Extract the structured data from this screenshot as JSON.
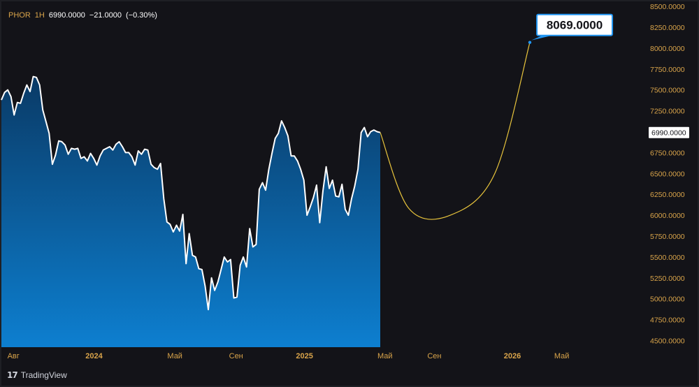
{
  "header": {
    "symbol": "PHOR",
    "interval": "1H",
    "last": "6990.0000",
    "change": "−21.0000",
    "change_pct": "(−0.30%)"
  },
  "branding": {
    "name": "TradingView"
  },
  "colors": {
    "background": "#1e1f24",
    "plot_background": "#131318",
    "price_line": "#ffffff",
    "area_top": "#0a3a66",
    "area_bottom": "#0d7fd0",
    "projection": "#e8c43c",
    "accent": "#2196f3",
    "axis_text": "#d9a44a"
  },
  "chart_data": {
    "type": "area",
    "price_label": "6990.0000",
    "target_label": "8069.0000",
    "y_ticks": [
      "8500.0000",
      "8250.0000",
      "8000.0000",
      "7750.0000",
      "7500.0000",
      "7250.0000",
      "7000.0000",
      "6750.0000",
      "6500.0000",
      "6250.0000",
      "6000.0000",
      "5750.0000",
      "5500.0000",
      "5250.0000",
      "5000.0000",
      "4750.0000",
      "4500.0000"
    ],
    "x_ticks": [
      {
        "label": "Авг",
        "t": 3.77
      },
      {
        "label": "2024",
        "t": 29.1
      },
      {
        "label": "Май",
        "t": 54.5
      },
      {
        "label": "Сен",
        "t": 73.7
      },
      {
        "label": "2025",
        "t": 95.2
      },
      {
        "label": "Май",
        "t": 120.5
      },
      {
        "label": "Сен",
        "t": 136.0
      },
      {
        "label": "2026",
        "t": 160.5
      },
      {
        "label": "Май",
        "t": 176.0
      }
    ],
    "ylim": [
      4420,
      8560
    ],
    "xlim": [
      0,
      202
    ],
    "series": [
      {
        "values": [
          7380,
          7470,
          7500,
          7420,
          7200,
          7350,
          7340,
          7460,
          7560,
          7480,
          7660,
          7650,
          7560,
          7260,
          7120,
          6980,
          6610,
          6720,
          6890,
          6880,
          6840,
          6730,
          6800,
          6790,
          6800,
          6680,
          6700,
          6650,
          6740,
          6680,
          6600,
          6710,
          6780,
          6800,
          6820,
          6780,
          6850,
          6880,
          6820,
          6750,
          6750,
          6700,
          6600,
          6770,
          6730,
          6790,
          6780,
          6610,
          6570,
          6550,
          6620,
          6200,
          5920,
          5890,
          5800,
          5880,
          5810,
          6010,
          5420,
          5780,
          5520,
          5500,
          5360,
          5350,
          5150,
          4870,
          5250,
          5100,
          5200,
          5350,
          5500,
          5440,
          5470,
          5010,
          5020,
          5400,
          5500,
          5380,
          5840,
          5620,
          5650,
          6310,
          6390,
          6300,
          6550,
          6740,
          6920,
          6980,
          7130,
          7050,
          6950,
          6710,
          6710,
          6650,
          6550,
          6420,
          6000,
          6100,
          6210,
          6360,
          5910,
          6290,
          6580,
          6320,
          6420,
          6230,
          6220,
          6370,
          6070,
          6000,
          6200,
          6350,
          6550,
          6990,
          7050,
          6940,
          7000,
          7020,
          7000,
          6990
        ]
      }
    ],
    "projection": {
      "name": "projection",
      "x": [
        119,
        128,
        141,
        155,
        166
      ],
      "y": [
        6990,
        6080,
        6000,
        6500,
        8069
      ]
    }
  }
}
